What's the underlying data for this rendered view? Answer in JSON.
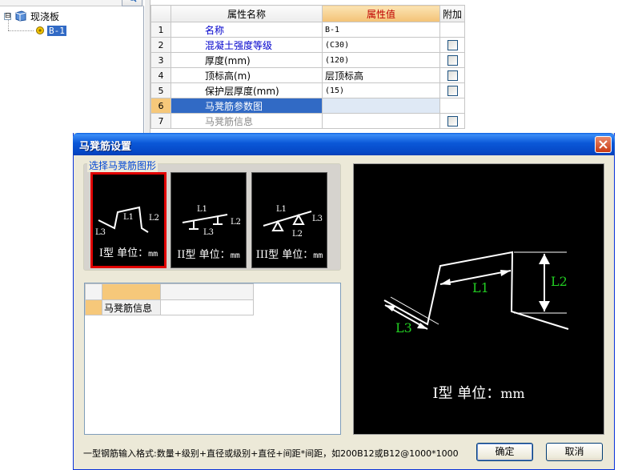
{
  "tree": {
    "root_label": "现浇板",
    "root_expander": "⊟",
    "child_label": "B-1"
  },
  "prop_grid": {
    "columns": [
      "属性名称",
      "属性值",
      "附加"
    ],
    "rows": [
      {
        "index": "1",
        "name": "名称",
        "value": "B-1",
        "has_check": false,
        "style": "blue"
      },
      {
        "index": "2",
        "name": "混凝土强度等级",
        "value": "(C30)",
        "has_check": true,
        "style": "blue"
      },
      {
        "index": "3",
        "name": "厚度(mm)",
        "value": "(120)",
        "has_check": true,
        "style": "normal"
      },
      {
        "index": "4",
        "name": "顶标高(m)",
        "value": "层顶标高",
        "has_check": true,
        "style": "normal"
      },
      {
        "index": "5",
        "name": "保护层厚度(mm)",
        "value": "(15)",
        "has_check": true,
        "style": "normal"
      },
      {
        "index": "6",
        "name": "马凳筋参数图",
        "value": "",
        "has_check": false,
        "style": "selected"
      },
      {
        "index": "7",
        "name": "马凳筋信息",
        "value": "",
        "has_check": true,
        "style": "disabled"
      }
    ]
  },
  "dialog": {
    "title": "马凳筋设置",
    "shape_group_label": "选择马凳筋图形",
    "shapes": [
      {
        "type": "I型",
        "unit_label": "单位：",
        "unit": "mm",
        "labels": [
          "L1",
          "L2",
          "L3"
        ]
      },
      {
        "type": "II型",
        "unit_label": "单位：",
        "unit": "mm",
        "labels": [
          "L1",
          "L2",
          "L3"
        ]
      },
      {
        "type": "III型",
        "unit_label": "单位：",
        "unit": "mm",
        "labels": [
          "L1",
          "L3",
          "L2"
        ]
      }
    ],
    "info_grid": {
      "label": "马凳筋信息",
      "value": ""
    },
    "preview": {
      "labels": [
        "L1",
        "L2",
        "L3"
      ],
      "caption_type": "I型",
      "caption_unit_label": "单位：",
      "caption_unit": "mm",
      "label_color": "#22cc22"
    },
    "format_hint": "一型钢筋输入格式:数量+级别+直径或级别+直径+间距*间距，如200B12或B12@1000*1000",
    "ok_label": "确定",
    "cancel_label": "取消"
  }
}
